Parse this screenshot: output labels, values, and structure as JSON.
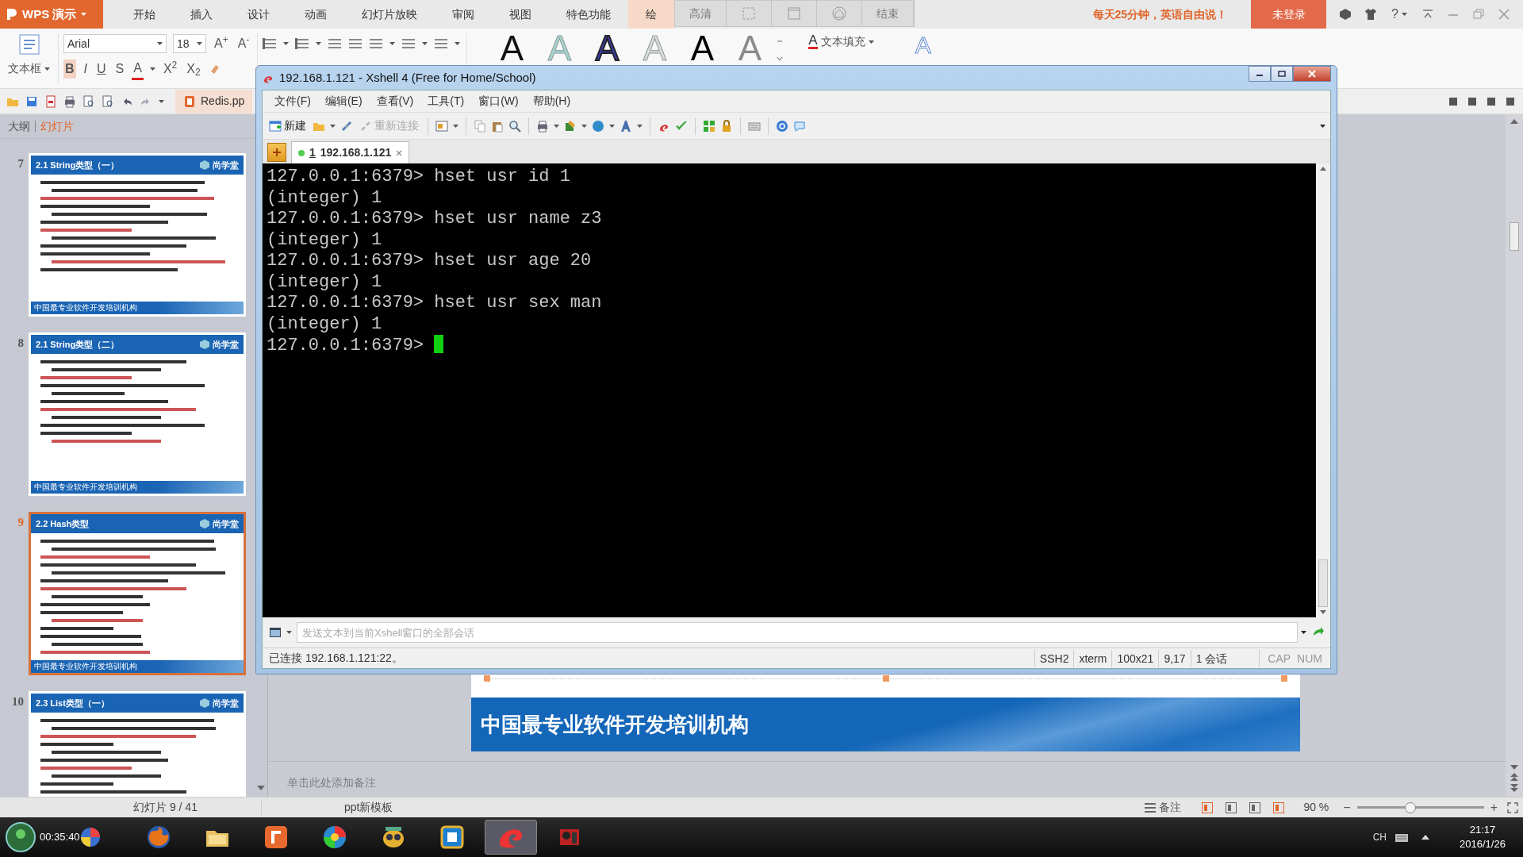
{
  "wps": {
    "app_button": "WPS 演示",
    "tabs": [
      {
        "label": "开始",
        "selected": false
      },
      {
        "label": "插入",
        "selected": false
      },
      {
        "label": "设计",
        "selected": false
      },
      {
        "label": "动画",
        "selected": false
      },
      {
        "label": "幻灯片放映",
        "selected": false
      },
      {
        "label": "审阅",
        "selected": false
      },
      {
        "label": "视图",
        "selected": false
      },
      {
        "label": "特色功能",
        "selected": false
      },
      {
        "label": "绘",
        "selected": true
      }
    ],
    "floating_buttons": [
      "高清",
      "结束"
    ],
    "promo": "每天25分钟，英语自由说！",
    "login": "未登录",
    "help_button": "?",
    "font_name": "Arial",
    "font_size": "18",
    "grow_font": "A$^{+}$",
    "shrink_font": "A$^{-}$",
    "format_buttons": [
      "B",
      "I",
      "U",
      "S"
    ],
    "font_color": "A",
    "superscript": "X$^{2}$",
    "subscript": "X$_{2}$",
    "text_box_label": "文本框",
    "wordart_styles": [
      {
        "text": "A",
        "kind": "solid",
        "color": "#111111"
      },
      {
        "text": "A",
        "kind": "glow",
        "color": "#a8d4d0"
      },
      {
        "text": "A",
        "kind": "outline",
        "color": "#3b3fb0"
      },
      {
        "text": "A",
        "kind": "glow",
        "color": "#dcdcdc"
      },
      {
        "text": "A",
        "kind": "solid",
        "color": "#000000"
      },
      {
        "text": "A",
        "kind": "solid",
        "color": "#8a8a8a"
      }
    ],
    "text_fill_label": "文本填充",
    "text_fill_icon": "A",
    "outline_style": "A",
    "document_tab": "Redis.pp",
    "panel_tabs": [
      {
        "label": "大纲",
        "selected": false
      },
      {
        "label": "幻灯片",
        "selected": true
      }
    ],
    "slides": [
      {
        "number": "7",
        "title": "2.1 String类型（一）",
        "logo": "尚学堂",
        "footer": "中国最专业软件开发培训机构",
        "selected": false
      },
      {
        "number": "8",
        "title": "2.1 String类型（二）",
        "logo": "尚学堂",
        "footer": "中国最专业软件开发培训机构",
        "selected": false
      },
      {
        "number": "9",
        "title": "2.2 Hash类型",
        "logo": "尚学堂",
        "footer": "中国最专业软件开发培训机构",
        "selected": true
      },
      {
        "number": "10",
        "title": "2.3 List类型（一）",
        "logo": "尚学堂",
        "selected": false
      }
    ],
    "slide_banner": "中国最专业软件开发培训机构",
    "notes_placeholder": "单击此处添加备注",
    "status": {
      "slide_counter": "幻灯片 9 / 41",
      "template": "ppt新模板",
      "notes_button": "备注",
      "zoom": "90 %",
      "zoom_out": "−",
      "zoom_in": "+",
      "zoom_slider": {
        "level": 0.42
      }
    }
  },
  "xshell": {
    "title": "192.168.1.121 - Xshell 4 (Free for Home/School)",
    "menu": [
      "文件(F)",
      "编辑(E)",
      "查看(V)",
      "工具(T)",
      "窗口(W)",
      "帮助(H)"
    ],
    "toolbar_buttons": [
      {
        "label": "新建",
        "disabled": false
      },
      {
        "label": "重新连接",
        "disabled": true
      }
    ],
    "session_tab": {
      "number": "1",
      "label": "192.168.1.121",
      "selected": true
    },
    "terminal": {
      "lines": [
        "127.0.0.1:6379> hset usr id 1",
        "(integer) 1",
        "127.0.0.1:6379> hset usr name z3",
        "(integer) 1",
        "127.0.0.1:6379> hset usr age 20",
        "(integer) 1",
        "127.0.0.1:6379> hset usr sex man",
        "(integer) 1"
      ],
      "prompt": "127.0.0.1:6379> "
    },
    "send_placeholder": "发送文本到当前Xshell窗口的全部会话",
    "status": {
      "connection": "已连接 192.168.1.121:22。",
      "items": [
        "SSH2",
        "xterm",
        "100x21",
        "9,17",
        "1 会话"
      ],
      "keys": [
        "CAP",
        "NUM"
      ]
    }
  },
  "taskbar": {
    "timer": "00:35:40",
    "apps": [
      {
        "kind": "fox",
        "selected": false
      },
      {
        "kind": "folder",
        "selected": false
      },
      {
        "kind": "presentation",
        "selected": false
      },
      {
        "kind": "wheel",
        "selected": false
      },
      {
        "kind": "mascot",
        "selected": false
      },
      {
        "kind": "box",
        "selected": false
      },
      {
        "kind": "swirl",
        "selected": true
      },
      {
        "kind": "media",
        "selected": false
      }
    ],
    "language": "CH",
    "time": "21:17",
    "date": "2016/1/26"
  }
}
